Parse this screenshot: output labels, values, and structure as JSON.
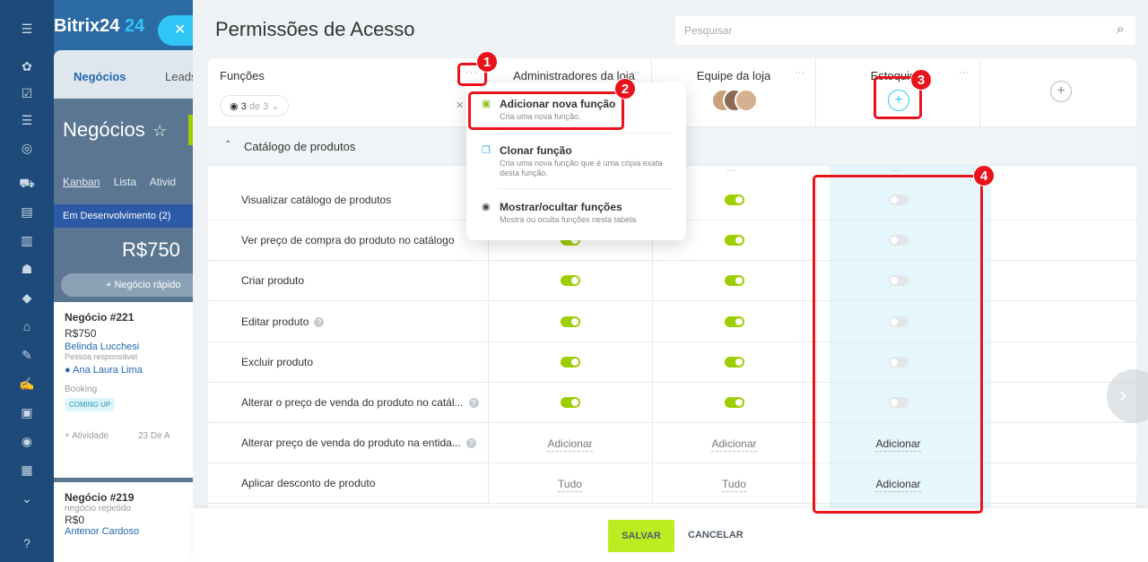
{
  "app": {
    "brand": "Bitrix24",
    "brand_num": "24"
  },
  "background": {
    "tabs": [
      "Negócios",
      "Leads"
    ],
    "page_title": "Negócios",
    "views": [
      "Kanban",
      "Lista",
      "Ativid"
    ],
    "stage": {
      "name": "Em Desenvolvimento",
      "count": "(2)"
    },
    "amount": "R$750",
    "quick_add": "+ Negócio rápido",
    "card1": {
      "title": "Negócio #221",
      "amount": "R$750",
      "contact": "Belinda Lucchesi",
      "responsible_label": "Pessoa responsável",
      "responsible": "Ana Laura Lima",
      "source": "Booking",
      "badge": "COMING UP",
      "activity": "+ Atividade",
      "date": "23 De A"
    },
    "card2": {
      "title": "Negócio #219",
      "note": "negócio repetido",
      "amount": "R$0",
      "contact": "Antenor Cardoso"
    }
  },
  "slider": {
    "title": "Permissões de Acesso",
    "search_placeholder": "Pesquisar",
    "roles_header": {
      "label": "Funções",
      "dots": "···",
      "count": "3",
      "count_suffix": "de 3"
    },
    "columns": [
      {
        "name": "Administradores da loja",
        "dots": "···"
      },
      {
        "name": "Equipe da loja",
        "dots": "···"
      },
      {
        "name": "Estoquista",
        "dots": "···",
        "add_label": "+"
      }
    ],
    "add_column_label": "+",
    "section": {
      "label": "Catálogo de produtos"
    },
    "subheader_dots": "···",
    "rows": [
      {
        "label": "Visualizar catálogo de produtos",
        "help": false,
        "values": [
          "on",
          "on",
          "off"
        ]
      },
      {
        "label": "Ver preço de compra do produto no catálogo",
        "help": false,
        "values": [
          "on",
          "on",
          "off"
        ]
      },
      {
        "label": "Criar produto",
        "help": false,
        "values": [
          "on",
          "on",
          "off"
        ]
      },
      {
        "label": "Editar produto",
        "help": true,
        "values": [
          "on",
          "on",
          "off"
        ]
      },
      {
        "label": "Excluir produto",
        "help": false,
        "values": [
          "on",
          "on",
          "off"
        ]
      },
      {
        "label": "Alterar o preço de venda do produto no catál...",
        "help": true,
        "values": [
          "on",
          "on",
          "off"
        ]
      },
      {
        "label": "Alterar preço de venda do produto na entida...",
        "help": true,
        "values": [
          "Adicionar",
          "Adicionar",
          "Adicionar"
        ]
      },
      {
        "label": "Aplicar desconto de produto",
        "help": false,
        "values": [
          "Tudo",
          "Tudo",
          "Adicionar"
        ]
      }
    ],
    "help_glyph": "?",
    "footer": {
      "save": "SALVAR",
      "cancel": "CANCELAR"
    }
  },
  "menu": {
    "items": [
      {
        "title": "Adicionar nova função",
        "desc": "Cria uma nova função."
      },
      {
        "title": "Clonar função",
        "desc": "Cria uma nova função que é uma cópia exata desta função."
      },
      {
        "title": "Mostrar/ocultar funções",
        "desc": "Mostra ou oculta funções nesta tabela."
      }
    ]
  },
  "annotations": [
    "1",
    "2",
    "3",
    "4"
  ],
  "colors": {
    "accent": "#2fc6f6",
    "toggle_on": "#9dcf00",
    "save": "#bbed21",
    "annotation": "#e8131b"
  },
  "icons": [
    "menu-icon",
    "search-icon",
    "close-icon",
    "eye-icon",
    "help-icon",
    "plus-icon",
    "chevron-up-icon",
    "chevron-right-icon",
    "more-icon"
  ]
}
